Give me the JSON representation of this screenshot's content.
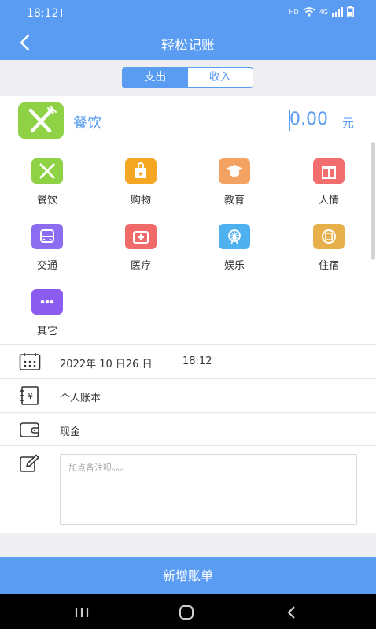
{
  "status_bar": {
    "time": "18:12",
    "network": "HD",
    "signal_label": "4G"
  },
  "header": {
    "title": "轻松记账"
  },
  "type_tabs": [
    {
      "label": "支出",
      "active": true
    },
    {
      "label": "收入",
      "active": false
    }
  ],
  "selected": {
    "category": "餐饮",
    "amount": "0.00",
    "unit": "元"
  },
  "categories": [
    {
      "label": "餐饮",
      "icon": "fork-knife-icon",
      "color": "#8fd246"
    },
    {
      "label": "购物",
      "icon": "shopping-bag-icon",
      "color": "#f5a623"
    },
    {
      "label": "教育",
      "icon": "graduation-cap-icon",
      "color": "#f4a261"
    },
    {
      "label": "人情",
      "icon": "gift-icon",
      "color": "#f26d6d"
    },
    {
      "label": "交通",
      "icon": "bus-icon",
      "color": "#8c6cf0"
    },
    {
      "label": "医疗",
      "icon": "medical-kit-icon",
      "color": "#f06a6a"
    },
    {
      "label": "娱乐",
      "icon": "ferris-wheel-icon",
      "color": "#4fb0f0"
    },
    {
      "label": "住宿",
      "icon": "hotel-icon",
      "color": "#e8b04a"
    },
    {
      "label": "其它",
      "icon": "more-dots-icon",
      "color": "#8c5cf0"
    }
  ],
  "details": {
    "date": "2022年 10 日26 日",
    "time": "18:12",
    "account_book": "个人账本",
    "payment": "现金",
    "note_placeholder": "加点备注呗。。。"
  },
  "submit_label": "新增账单",
  "colors": {
    "primary": "#5a9cf2",
    "background": "#efeff2"
  }
}
